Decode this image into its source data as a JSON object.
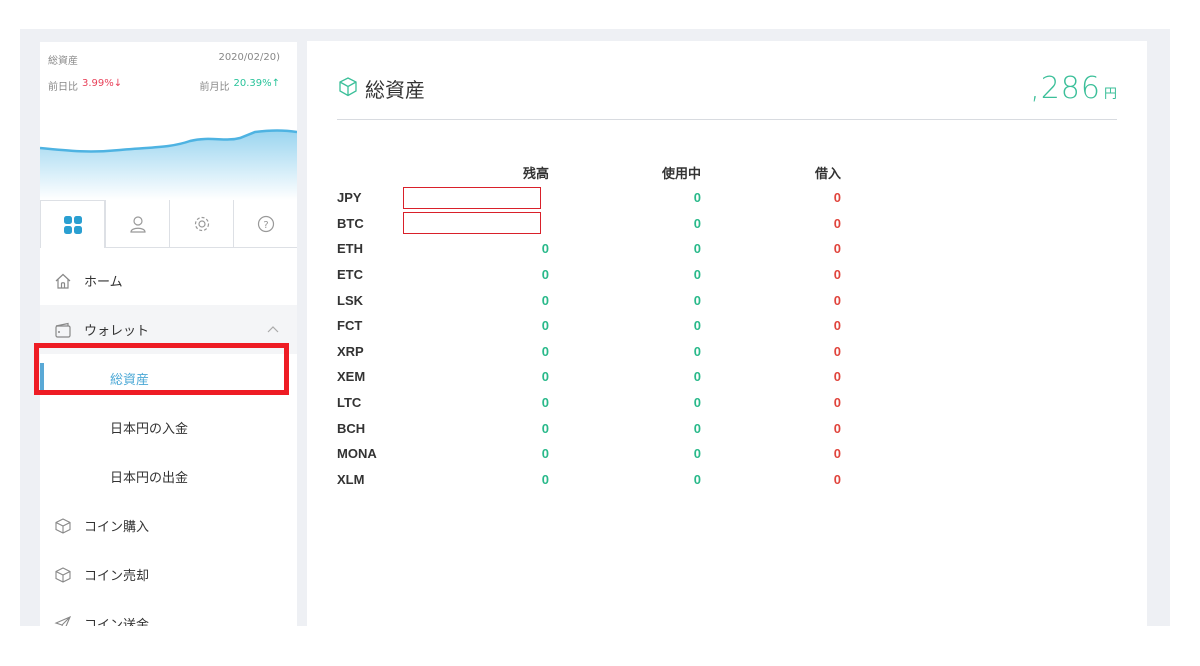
{
  "summary": {
    "label": "総資産",
    "date": "2020/02/20)",
    "day_label": "前日比",
    "day_value": "3.99%↓",
    "month_label": "前月比",
    "month_value": "20.39%↑"
  },
  "sidebar": {
    "tabs": [
      {
        "icon": "grid-icon"
      },
      {
        "icon": "user-icon"
      },
      {
        "icon": "gear-icon"
      },
      {
        "icon": "help-icon"
      }
    ],
    "items": [
      {
        "label": "ホーム",
        "icon": "home-icon"
      },
      {
        "label": "ウォレット",
        "icon": "wallet-icon"
      },
      {
        "label": "総資産"
      },
      {
        "label": "日本円の入金"
      },
      {
        "label": "日本円の出金"
      },
      {
        "label": "コイン購入",
        "icon": "box-icon"
      },
      {
        "label": "コイン売却",
        "icon": "box-icon"
      },
      {
        "label": "コイン送金",
        "icon": "send-icon"
      }
    ]
  },
  "main": {
    "title": "総資産",
    "total_value": ",286",
    "total_unit": "円",
    "columns": [
      "残高",
      "使用中",
      "借入"
    ],
    "rows": [
      {
        "currency": "JPY",
        "balance": "",
        "in_use": "0",
        "borrowed": "0"
      },
      {
        "currency": "BTC",
        "balance": "",
        "in_use": "0",
        "borrowed": "0"
      },
      {
        "currency": "ETH",
        "balance": "0",
        "in_use": "0",
        "borrowed": "0"
      },
      {
        "currency": "ETC",
        "balance": "0",
        "in_use": "0",
        "borrowed": "0"
      },
      {
        "currency": "LSK",
        "balance": "0",
        "in_use": "0",
        "borrowed": "0"
      },
      {
        "currency": "FCT",
        "balance": "0",
        "in_use": "0",
        "borrowed": "0"
      },
      {
        "currency": "XRP",
        "balance": "0",
        "in_use": "0",
        "borrowed": "0"
      },
      {
        "currency": "XEM",
        "balance": "0",
        "in_use": "0",
        "borrowed": "0"
      },
      {
        "currency": "LTC",
        "balance": "0",
        "in_use": "0",
        "borrowed": "0"
      },
      {
        "currency": "BCH",
        "balance": "0",
        "in_use": "0",
        "borrowed": "0"
      },
      {
        "currency": "MONA",
        "balance": "0",
        "in_use": "0",
        "borrowed": "0"
      },
      {
        "currency": "XLM",
        "balance": "0",
        "in_use": "0",
        "borrowed": "0"
      }
    ]
  },
  "colors": {
    "accent_green": "#29b98a",
    "accent_red": "#e0443c",
    "accent_blue": "#5aa9d6",
    "highlight_red": "#ee1c24"
  }
}
